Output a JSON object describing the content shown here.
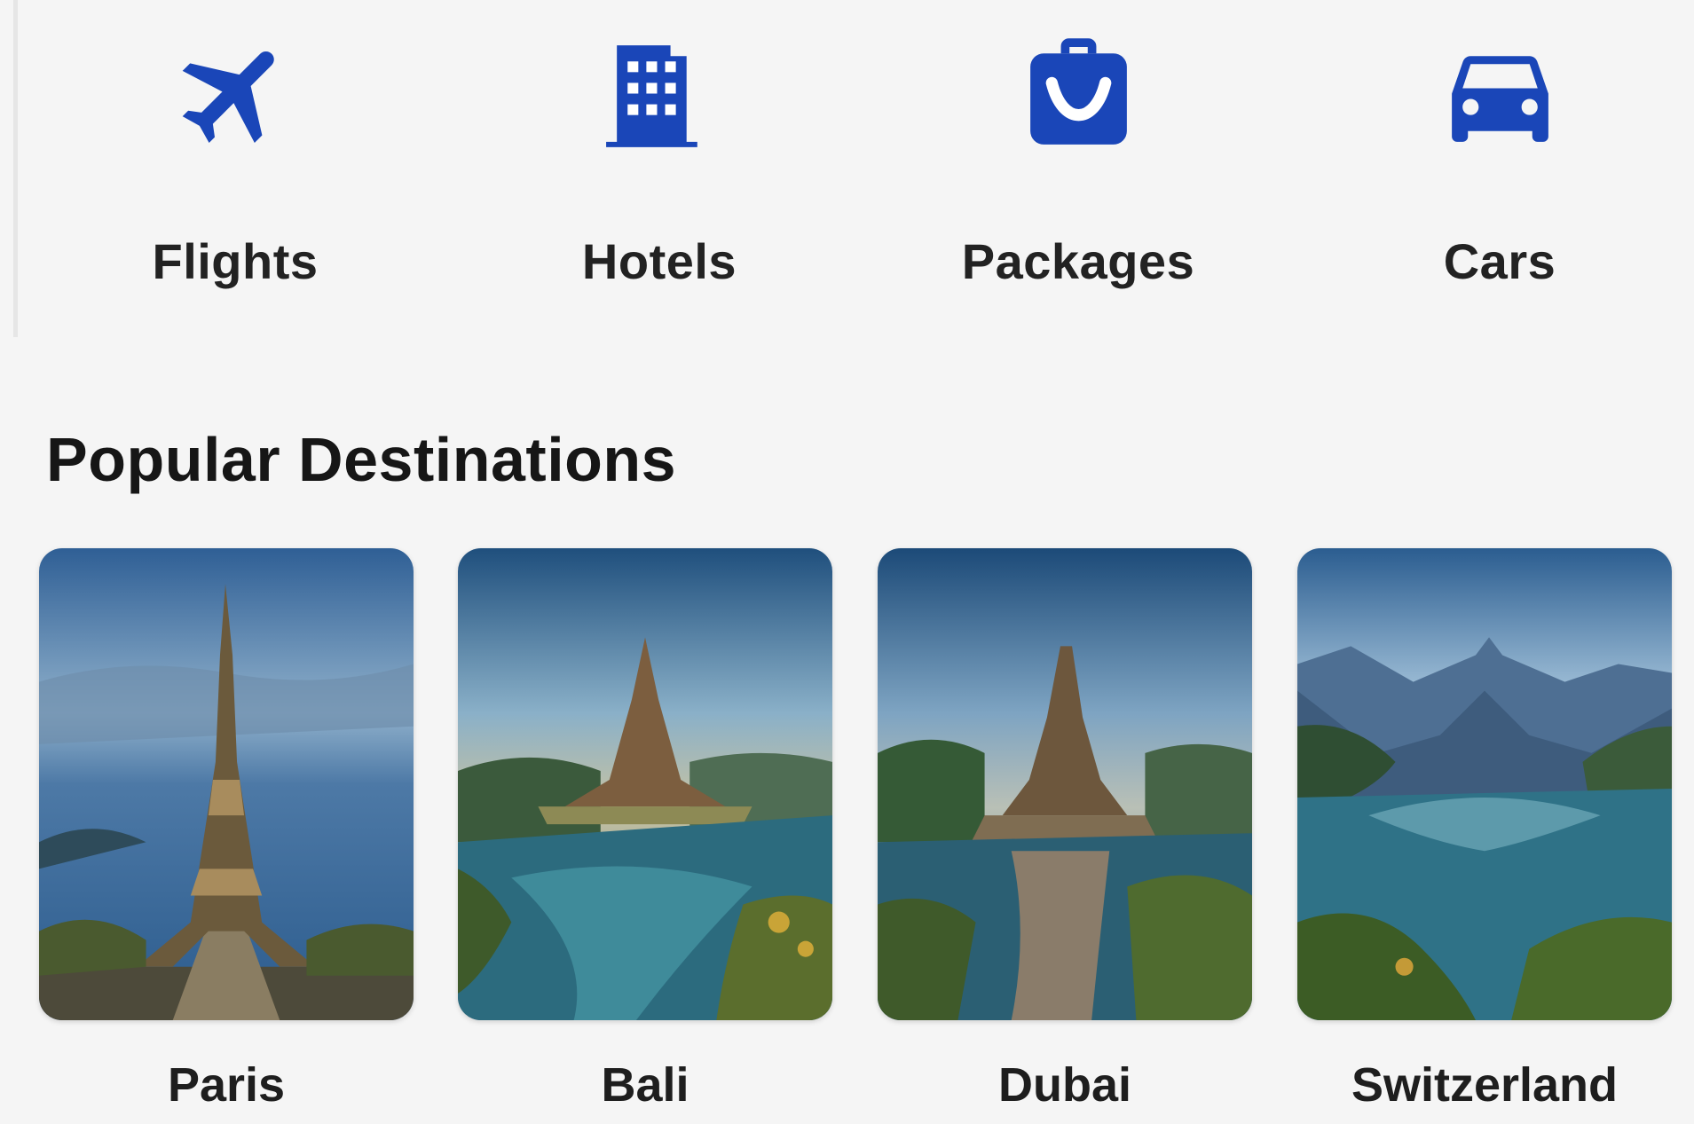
{
  "accent_color": "#1a46b8",
  "categories": [
    {
      "label": "Flights",
      "icon": "airplane-icon"
    },
    {
      "label": "Hotels",
      "icon": "hotel-building-icon"
    },
    {
      "label": "Packages",
      "icon": "luggage-icon"
    },
    {
      "label": "Cars",
      "icon": "car-icon"
    }
  ],
  "section_title": "Popular Destinations",
  "destinations": [
    {
      "name": "Paris"
    },
    {
      "name": "Bali"
    },
    {
      "name": "Dubai"
    },
    {
      "name": "Switzerland"
    }
  ]
}
